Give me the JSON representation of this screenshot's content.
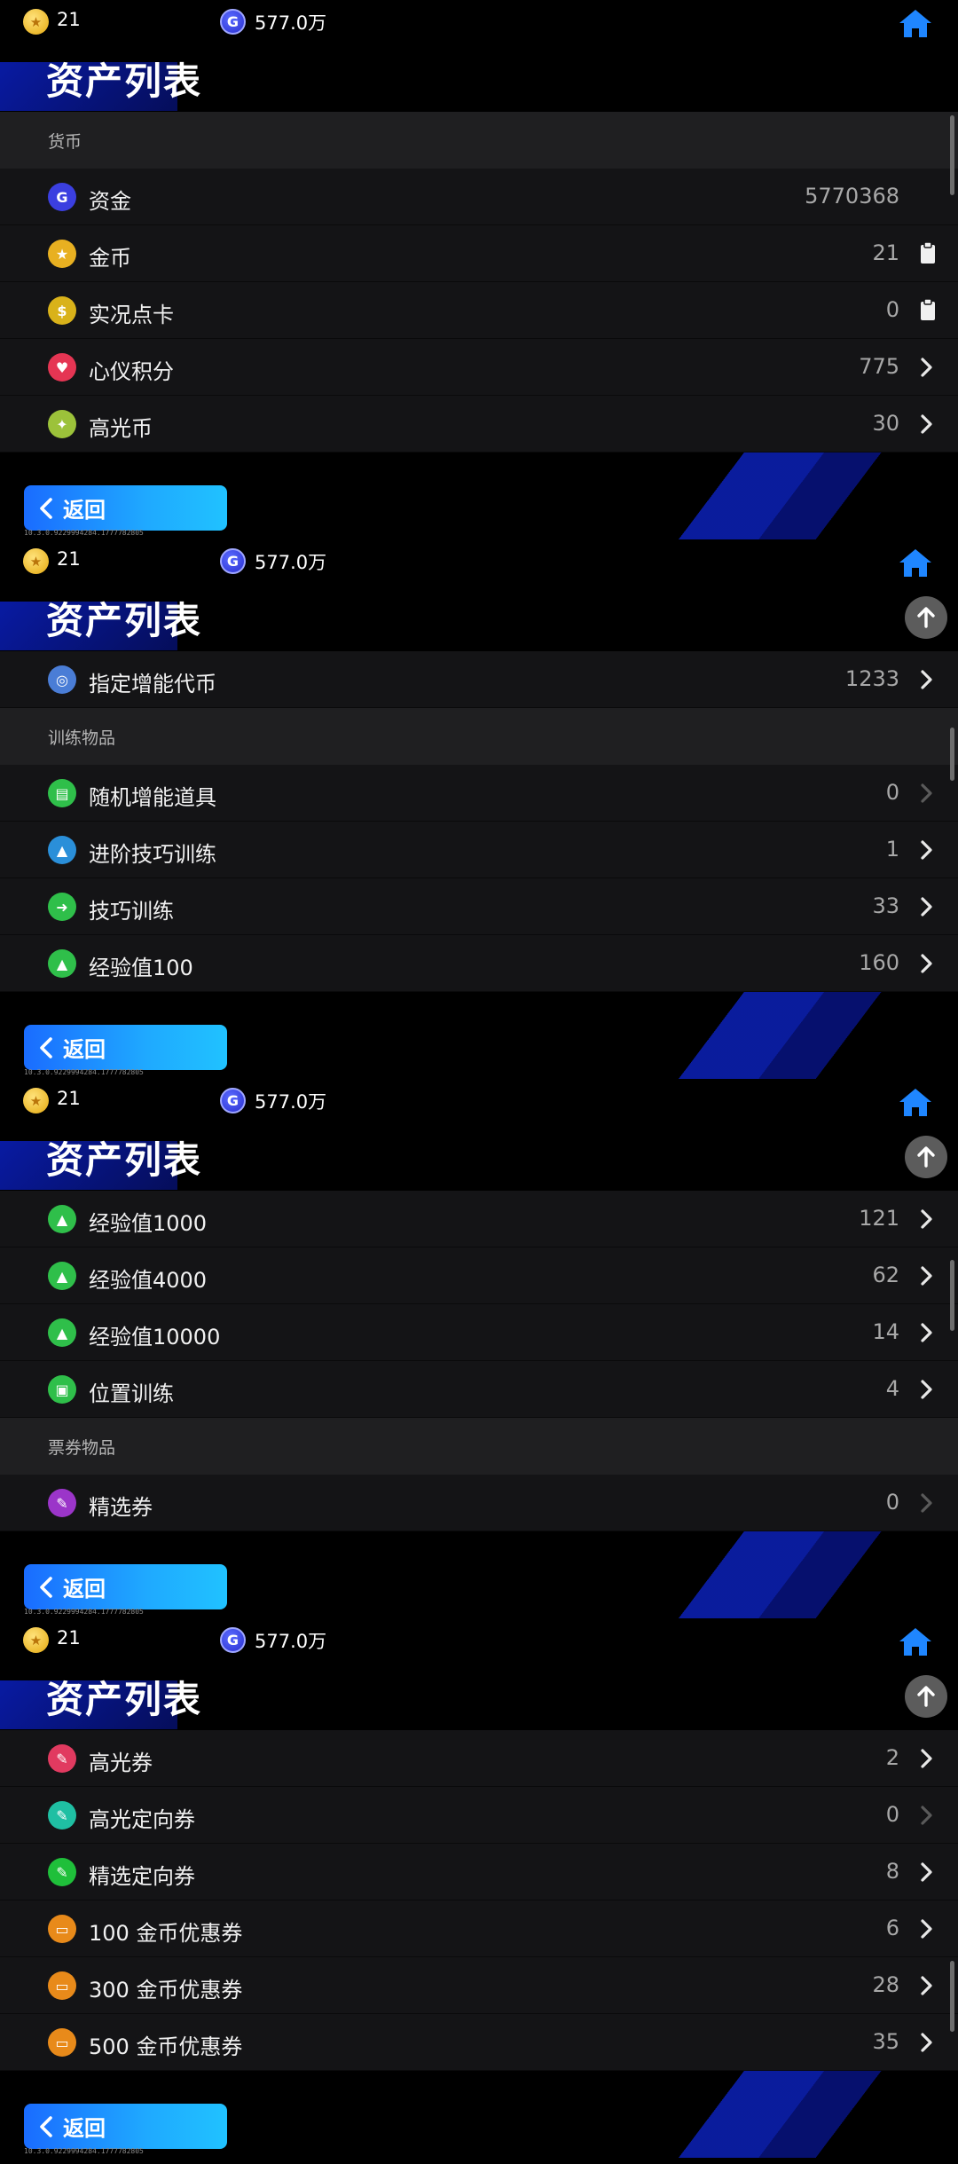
{
  "header": {
    "coin_value": "21",
    "g_letter": "G",
    "g_value": "577.0万",
    "title": "资产列表"
  },
  "back_label": "返回",
  "version": "10.3.0.9229994284.1777782805",
  "colors": {
    "accent": "#1a8cff",
    "row_bg": "#141416",
    "section_bg": "#1f1f21"
  },
  "panels": [
    {
      "show_up_button": false,
      "items": [
        {
          "kind": "section",
          "label": "货币"
        },
        {
          "kind": "row",
          "icon": "g-coin-icon",
          "color": "#3b3fe0",
          "glyph": "G",
          "label": "资金",
          "value": "5770368",
          "action": "none"
        },
        {
          "kind": "row",
          "icon": "gold-coin-icon",
          "color": "#e8b021",
          "glyph": "★",
          "label": "金币",
          "value": "21",
          "action": "clipboard"
        },
        {
          "kind": "row",
          "icon": "dollar-coin-icon",
          "color": "#d9b21a",
          "glyph": "$",
          "label": "实况点卡",
          "value": "0",
          "action": "clipboard"
        },
        {
          "kind": "row",
          "icon": "heart-icon",
          "color": "#e53553",
          "glyph": "♥",
          "label": "心仪积分",
          "value": "775",
          "action": "chevron"
        },
        {
          "kind": "row",
          "icon": "highlight-coin-icon",
          "color": "#9cc23a",
          "glyph": "✦",
          "label": "高光币",
          "value": "30",
          "action": "chevron"
        }
      ]
    },
    {
      "show_up_button": true,
      "items": [
        {
          "kind": "row",
          "icon": "boost-token-icon",
          "color": "#4a7dd6",
          "glyph": "◎",
          "label": "指定增能代币",
          "value": "1233",
          "action": "chevron"
        },
        {
          "kind": "section",
          "label": "训练物品"
        },
        {
          "kind": "row",
          "icon": "random-boost-icon",
          "color": "#2fbf4a",
          "glyph": "▤",
          "label": "随机增能道具",
          "value": "0",
          "action": "chevron-dim"
        },
        {
          "kind": "row",
          "icon": "advanced-training-icon",
          "color": "#2a8fd9",
          "glyph": "▲",
          "label": "进阶技巧训练",
          "value": "1",
          "action": "chevron"
        },
        {
          "kind": "row",
          "icon": "skill-training-icon",
          "color": "#2fbf4a",
          "glyph": "➜",
          "label": "技巧训练",
          "value": "33",
          "action": "chevron"
        },
        {
          "kind": "row",
          "icon": "exp-100-icon",
          "color": "#2fbf4a",
          "glyph": "▲",
          "label": "经验值100",
          "value": "160",
          "action": "chevron"
        }
      ]
    },
    {
      "show_up_button": true,
      "items": [
        {
          "kind": "row",
          "icon": "exp-1000-icon",
          "color": "#2fbf4a",
          "glyph": "▲",
          "label": "经验值1000",
          "value": "121",
          "action": "chevron"
        },
        {
          "kind": "row",
          "icon": "exp-4000-icon",
          "color": "#2fbf4a",
          "glyph": "▲",
          "label": "经验值4000",
          "value": "62",
          "action": "chevron"
        },
        {
          "kind": "row",
          "icon": "exp-10000-icon",
          "color": "#2fbf4a",
          "glyph": "▲",
          "label": "经验值10000",
          "value": "14",
          "action": "chevron"
        },
        {
          "kind": "row",
          "icon": "position-training-icon",
          "color": "#2fbf4a",
          "glyph": "▣",
          "label": "位置训练",
          "value": "4",
          "action": "chevron"
        },
        {
          "kind": "section",
          "label": "票券物品"
        },
        {
          "kind": "row",
          "icon": "select-ticket-icon",
          "color": "#9b35c9",
          "glyph": "✎",
          "label": "精选券",
          "value": "0",
          "action": "chevron-dim"
        }
      ]
    },
    {
      "show_up_button": true,
      "items": [
        {
          "kind": "row",
          "icon": "highlight-ticket-icon",
          "color": "#e13a60",
          "glyph": "✎",
          "label": "高光券",
          "value": "2",
          "action": "chevron"
        },
        {
          "kind": "row",
          "icon": "highlight-directed-ticket-icon",
          "color": "#1fbfa3",
          "glyph": "✎",
          "label": "高光定向券",
          "value": "0",
          "action": "chevron-dim"
        },
        {
          "kind": "row",
          "icon": "select-directed-ticket-icon",
          "color": "#1fbf3a",
          "glyph": "✎",
          "label": "精选定向券",
          "value": "8",
          "action": "chevron"
        },
        {
          "kind": "row",
          "icon": "coupon-100-icon",
          "color": "#e88a1a",
          "glyph": "▭",
          "label": "100 金币优惠券",
          "value": "6",
          "action": "chevron"
        },
        {
          "kind": "row",
          "icon": "coupon-300-icon",
          "color": "#e88a1a",
          "glyph": "▭",
          "label": "300 金币优惠券",
          "value": "28",
          "action": "chevron"
        },
        {
          "kind": "row",
          "icon": "coupon-500-icon",
          "color": "#e88a1a",
          "glyph": "▭",
          "label": "500 金币优惠券",
          "value": "35",
          "action": "chevron"
        }
      ]
    }
  ]
}
